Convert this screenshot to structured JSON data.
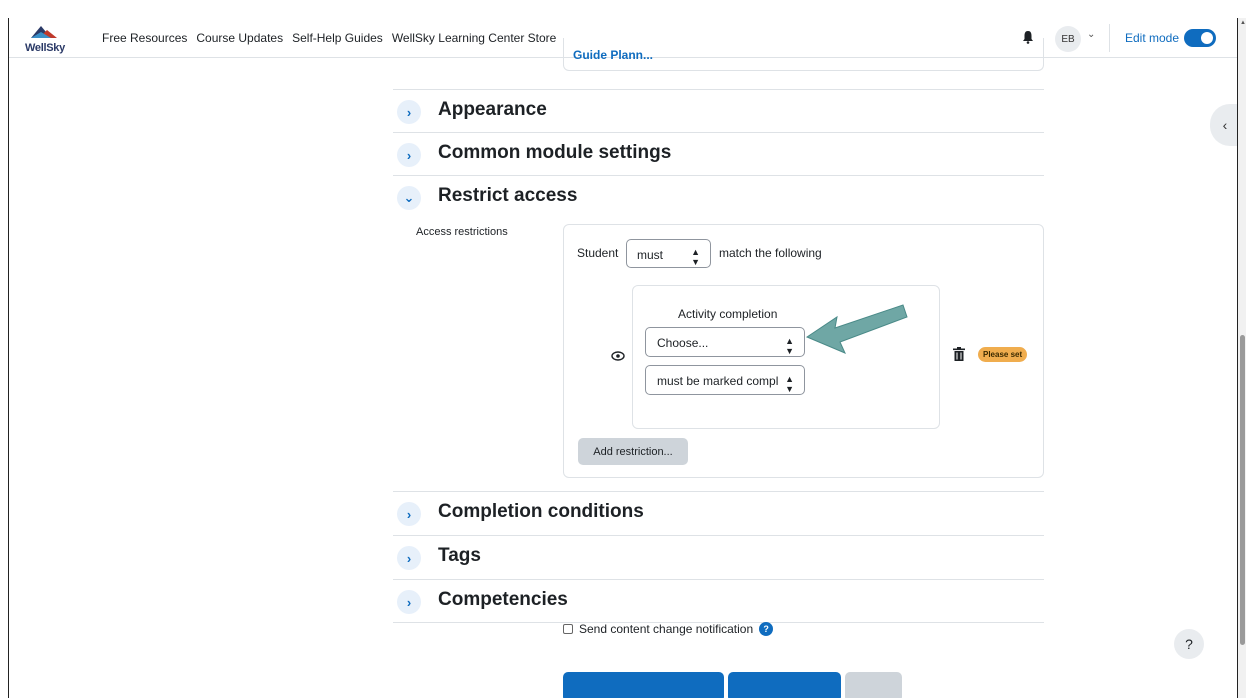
{
  "nav": {
    "logo": "WellSky",
    "links": [
      "Free Resources",
      "Course Updates",
      "Self-Help Guides",
      "WellSky Learning Center Store"
    ],
    "user_initials": "EB",
    "edit_mode_label": "Edit mode",
    "edit_mode_on": true
  },
  "guide_link": "Guide Plann...",
  "sections": [
    {
      "title": "Appearance",
      "expanded": false
    },
    {
      "title": "Common module settings",
      "expanded": false
    },
    {
      "title": "Restrict access",
      "expanded": true
    },
    {
      "title": "Completion conditions",
      "expanded": false
    },
    {
      "title": "Tags",
      "expanded": false
    },
    {
      "title": "Competencies",
      "expanded": false
    }
  ],
  "restrict": {
    "label": "Access restrictions",
    "student_label": "Student",
    "must_value": "must",
    "match_text": "match the following",
    "condition_title": "Activity completion",
    "choose_value": "Choose...",
    "completion_value": "must be marked compl",
    "badge": "Please set",
    "add_button": "Add restriction..."
  },
  "notify_label": "Send content change notification",
  "help_label": "?",
  "colors": {
    "accent": "#0f6cbf",
    "arrow": "#6fa7a5",
    "badge": "#f0ad4e"
  }
}
